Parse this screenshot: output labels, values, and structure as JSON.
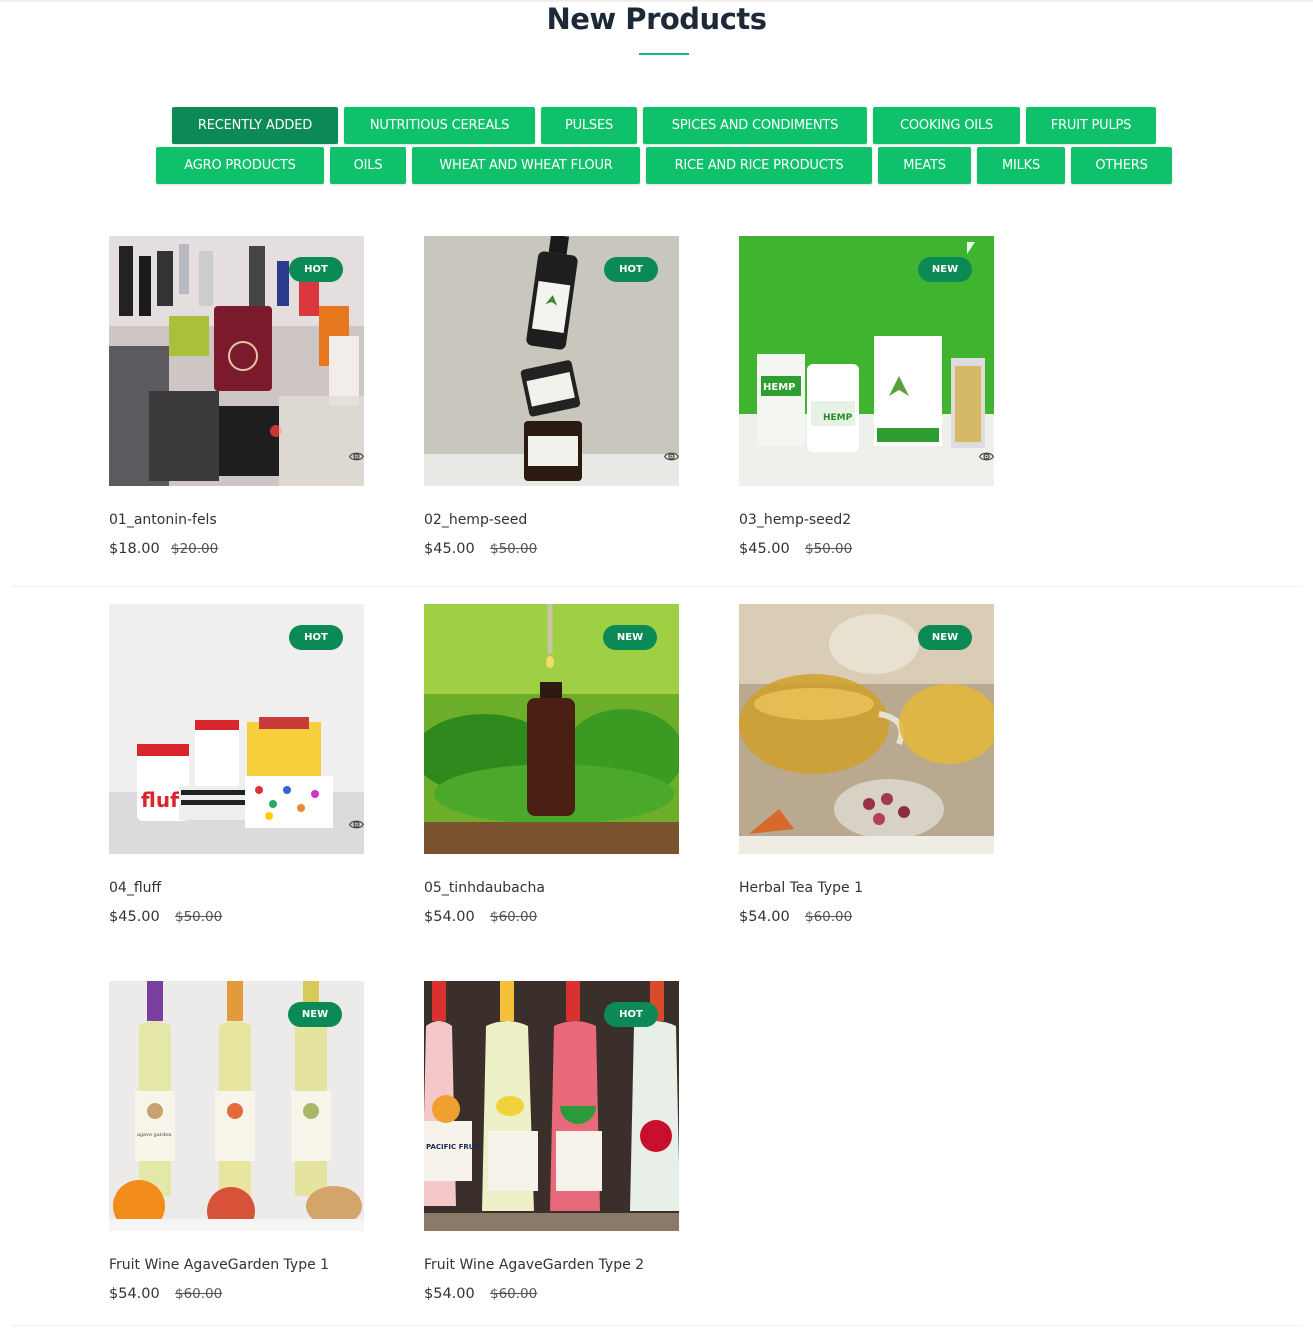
{
  "section": {
    "title": "New Products"
  },
  "filters": [
    {
      "label": "RECENTLY ADDED",
      "active": true
    },
    {
      "label": "NUTRITIOUS CEREALS",
      "active": false
    },
    {
      "label": "PULSES",
      "active": false
    },
    {
      "label": "SPICES AND CONDIMENTS",
      "active": false
    },
    {
      "label": "COOKING OILS",
      "active": false
    },
    {
      "label": "FRUIT PULPS",
      "active": false
    },
    {
      "label": "AGRO PRODUCTS",
      "active": false
    },
    {
      "label": "OILS",
      "active": false
    },
    {
      "label": "WHEAT AND WHEAT FLOUR",
      "active": false
    },
    {
      "label": "RICE AND RICE PRODUCTS",
      "active": false
    },
    {
      "label": "MEATS",
      "active": false
    },
    {
      "label": "MILKS",
      "active": false
    },
    {
      "label": "OTHERS",
      "active": false
    }
  ],
  "products": [
    {
      "name": "01_antonin-fels",
      "price": "$18.00",
      "old_price": "$20.00",
      "badge": "HOT"
    },
    {
      "name": "02_hemp-seed",
      "price": "$45.00",
      "old_price": "$50.00",
      "badge": "HOT"
    },
    {
      "name": "03_hemp-seed2",
      "price": "$45.00",
      "old_price": "$50.00",
      "badge": "NEW"
    },
    {
      "name": "04_fluff",
      "price": "$45.00",
      "old_price": "$50.00",
      "badge": "HOT"
    },
    {
      "name": "05_tinhdaubacha",
      "price": "$54.00",
      "old_price": "$60.00",
      "badge": "NEW"
    },
    {
      "name": "Herbal Tea Type 1",
      "price": "$54.00",
      "old_price": "$60.00",
      "badge": "NEW"
    },
    {
      "name": "Fruit Wine AgaveGarden Type 1",
      "price": "$54.00",
      "old_price": "$60.00",
      "badge": "NEW"
    },
    {
      "name": "Fruit Wine AgaveGarden Type 2",
      "price": "$54.00",
      "old_price": "$60.00",
      "badge": "HOT"
    }
  ],
  "image_text": {
    "hemp_label": "HEMP",
    "hemp_label_2": "HEMP",
    "fluff": "fluff",
    "pacific": "PACIFIC FRUIT",
    "agave": "agave garden"
  },
  "colors": {
    "accent": "#0fc16a",
    "accent_dark": "#0b8a55",
    "title": "#1d2939"
  }
}
